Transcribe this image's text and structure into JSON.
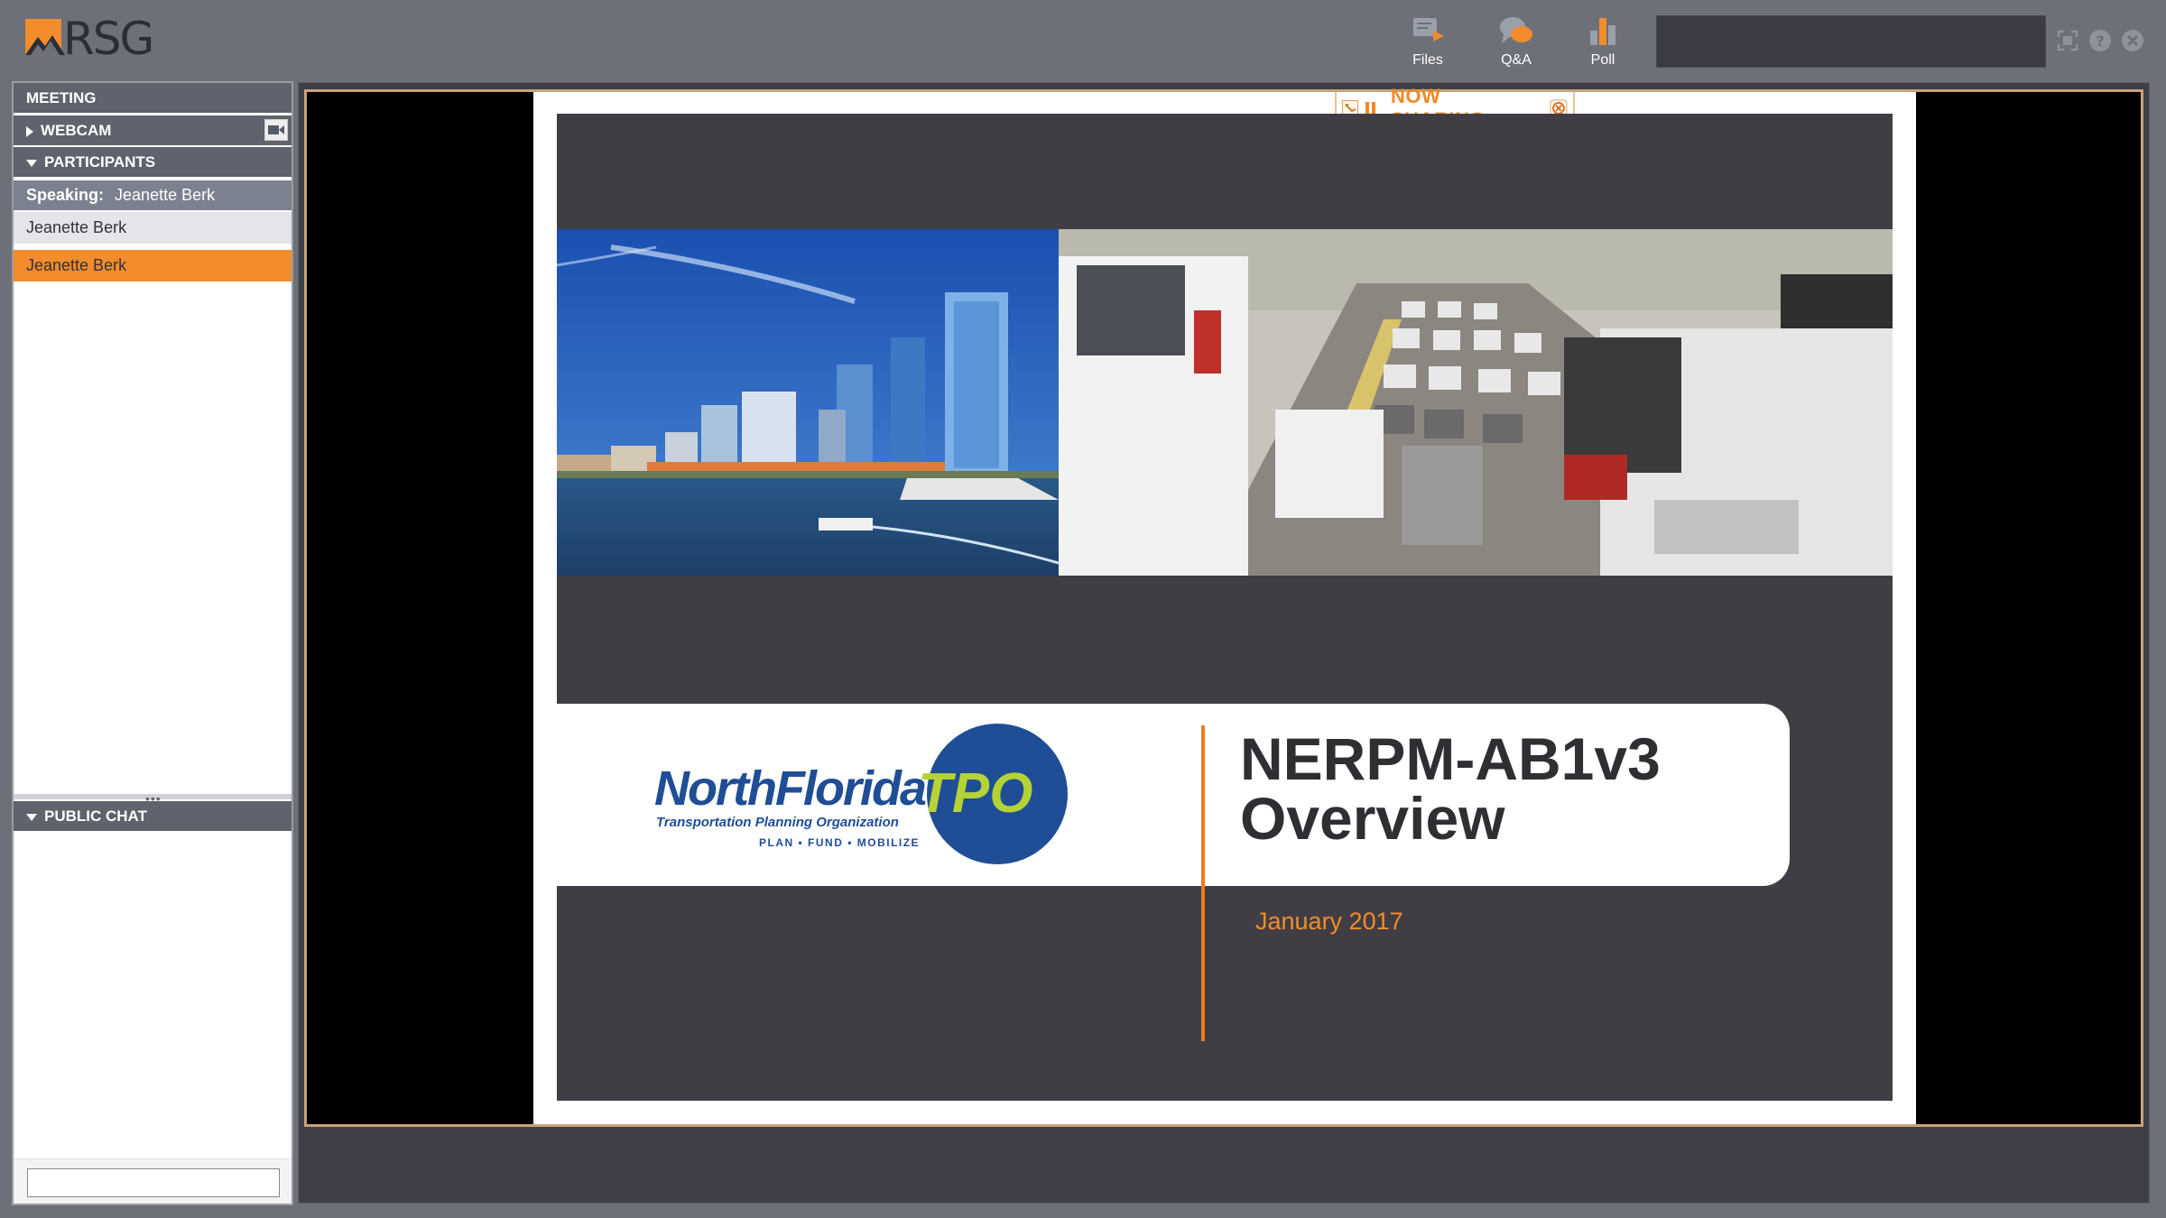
{
  "app": {
    "brand": "RSG"
  },
  "toolbar": {
    "files_label": "Files",
    "qa_label": "Q&A",
    "poll_label": "Poll"
  },
  "sidebar": {
    "meeting_label": "MEETING",
    "webcam_label": "WEBCAM",
    "participants_label": "PARTICIPANTS",
    "speaking_label": "Speaking:",
    "speaking_name": "Jeanette Berk",
    "participants": [
      {
        "name": "Jeanette Berk",
        "selected": false
      },
      {
        "name": "Jeanette Berk",
        "selected": true
      }
    ],
    "public_chat_label": "PUBLIC CHAT",
    "chat_input_value": ""
  },
  "stage": {
    "now_sharing_label": "NOW SHARING",
    "slide": {
      "logo_text_north": "NorthFlorida",
      "logo_text_tpo": "TPO",
      "logo_subtitle": "Transportation Planning Organization",
      "logo_tagline": "PLAN • FUND • MOBILIZE",
      "title_line1": "NERPM-AB1v3",
      "title_line2": "Overview",
      "date": "January 2017"
    }
  },
  "colors": {
    "accent_orange": "#f28c2d",
    "header_gray": "#5f636d",
    "slide_dark": "#403e44",
    "tpo_blue": "#1f4e96",
    "tpo_green": "#b5d335"
  }
}
